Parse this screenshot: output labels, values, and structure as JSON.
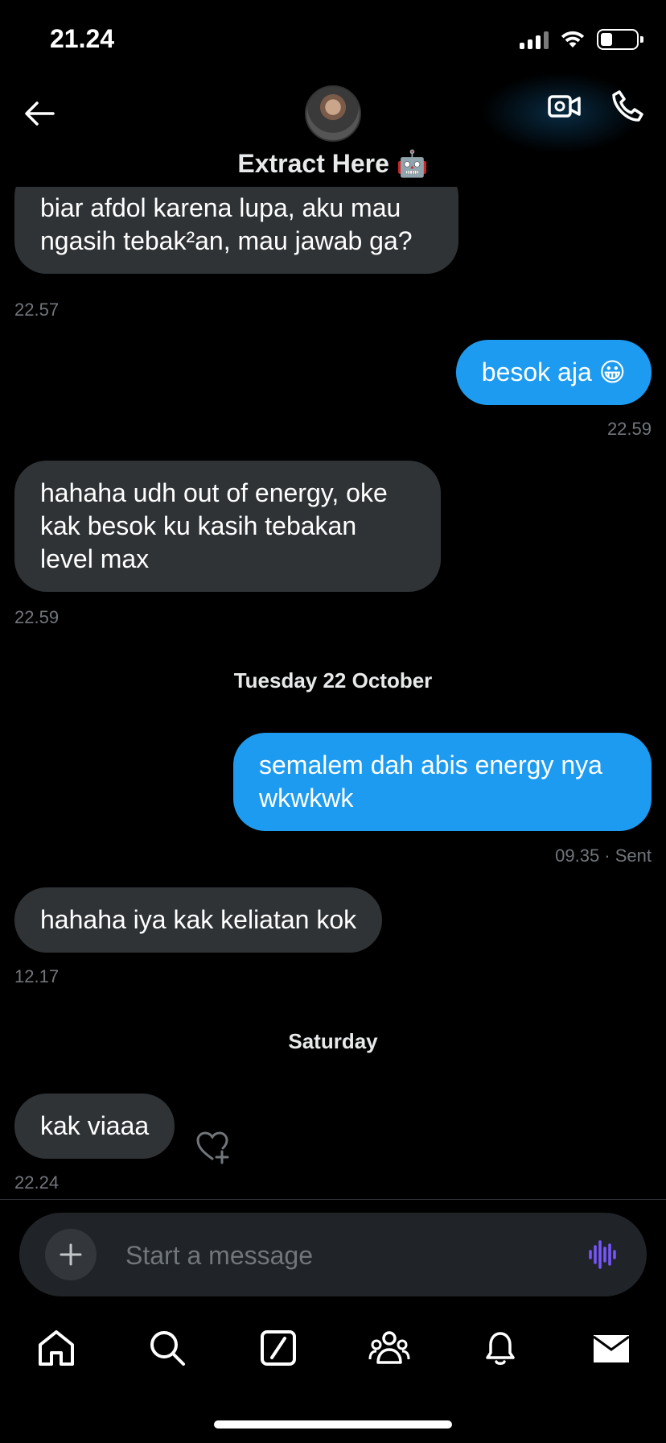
{
  "status_bar": {
    "time": "21.24"
  },
  "header": {
    "contact_name": "Extract Here 🤖",
    "icons": [
      "back-arrow-icon",
      "video-call-icon",
      "phone-icon"
    ]
  },
  "messages": [
    {
      "direction": "in",
      "text": "biar afdol karena lupa, aku mau ngasih tebak²an, mau jawab ga?",
      "time": "22.57"
    },
    {
      "direction": "out",
      "text": "besok aja 😀",
      "time": "22.59"
    },
    {
      "direction": "in",
      "text": "hahaha udh out of energy, oke kak besok ku kasih tebakan level max",
      "time": "22.59"
    },
    {
      "separator": "Tuesday 22 October"
    },
    {
      "direction": "out",
      "text": "semalem dah abis energy nya wkwkwk",
      "time": "09.35 · Sent"
    },
    {
      "direction": "in",
      "text": "hahaha iya kak keliatan kok",
      "time": "12.17"
    },
    {
      "separator": "Saturday"
    },
    {
      "direction": "in",
      "text": "kak viaaa",
      "time": "22.24"
    }
  ],
  "composer": {
    "placeholder": "Start a message"
  },
  "bottom_nav": {
    "items": [
      "home-icon",
      "search-icon",
      "grok-icon",
      "communities-icon",
      "notifications-icon",
      "messages-icon"
    ]
  },
  "colors": {
    "background": "#000000",
    "bubble_in": "#2f3336",
    "bubble_out": "#1d9bf0",
    "meta": "#71767b",
    "voice_accent": "#7856ff"
  }
}
